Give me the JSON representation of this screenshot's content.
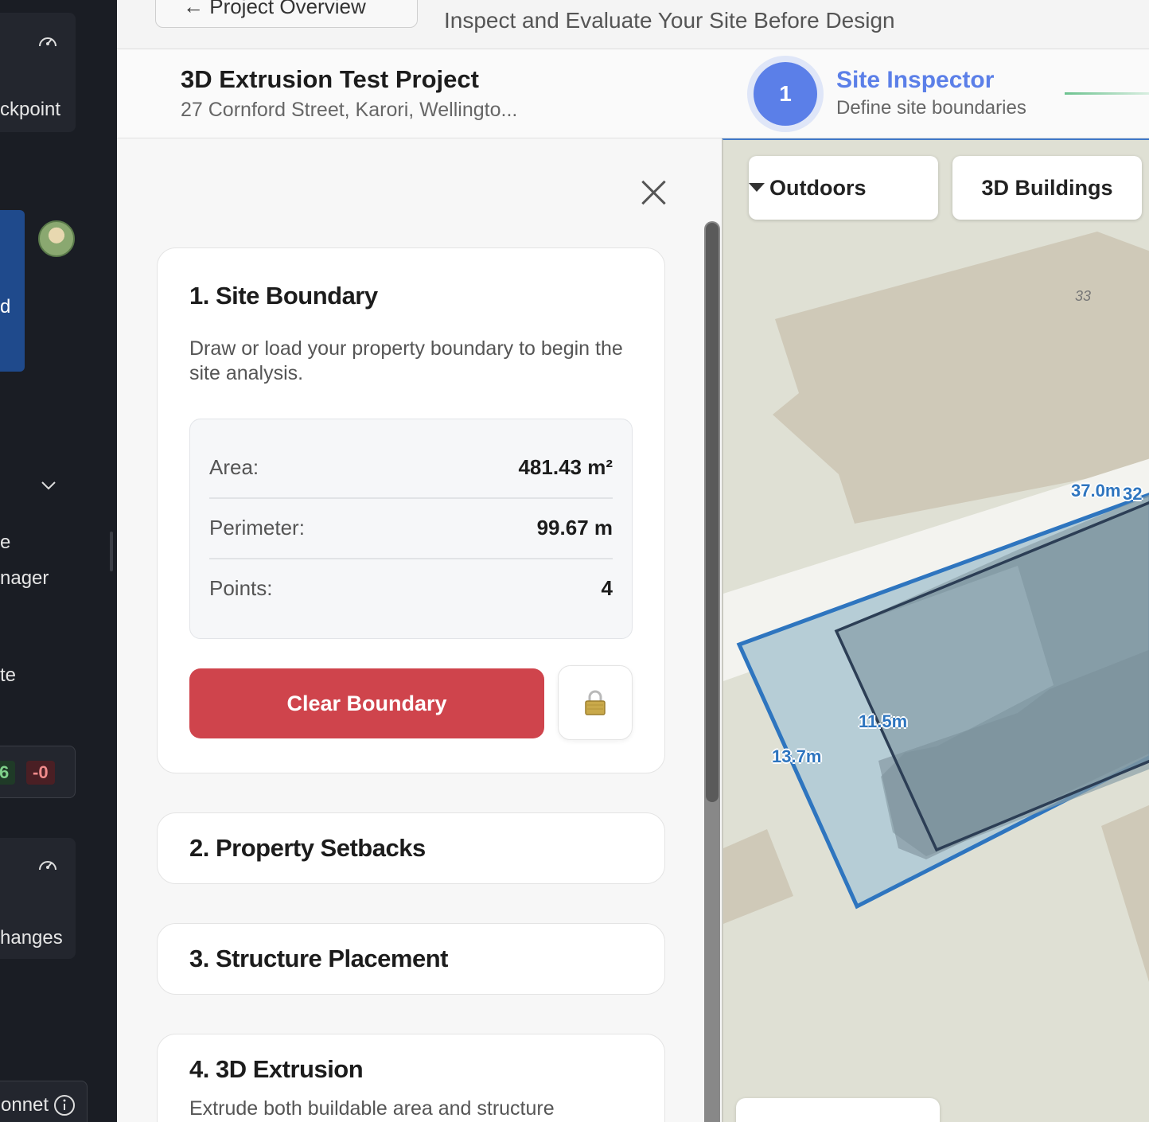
{
  "sidebar": {
    "checkpoint_label": "ckpoint",
    "blue_card_text": "d",
    "item_e": "e",
    "item_manager": "nager",
    "item_te": "te",
    "badge_added": "6",
    "badge_removed": "-0",
    "changes_label": "hanges",
    "model_label": "onnet"
  },
  "header": {
    "back_label": "← Project Overview",
    "subtitle": "Inspect and Evaluate Your Site Before Design"
  },
  "project": {
    "title": "3D Extrusion Test Project",
    "address": "27 Cornford Street, Karori, Wellingto..."
  },
  "step": {
    "number": "1",
    "title": "Site Inspector",
    "subtitle": "Define site boundaries"
  },
  "sections": {
    "site_boundary": {
      "title": "1. Site Boundary",
      "description": "Draw or load your property boundary to begin the site analysis.",
      "stats": [
        {
          "label": "Area:",
          "value": "481.43 m²"
        },
        {
          "label": "Perimeter:",
          "value": "99.67 m"
        },
        {
          "label": "Points:",
          "value": "4"
        }
      ],
      "clear_label": "Clear Boundary",
      "lock_glyph": "🔒"
    },
    "setbacks": {
      "title": "2. Property Setbacks"
    },
    "placement": {
      "title": "3. Structure Placement"
    },
    "extrusion": {
      "title": "4. 3D Extrusion",
      "description": "Extrude both buildable area and structure"
    }
  },
  "map": {
    "style_select": "Outdoors",
    "buildings_toggle": "3D Buildings",
    "lot_number": "33",
    "dimensions": [
      "37.0m",
      "32",
      "11.5m",
      "13.7m"
    ],
    "boundary_color": "#2e75bf",
    "structure_color": "#2c3e55"
  },
  "icons": {
    "close": "close-icon",
    "lock": "lock-icon",
    "dropdown": "caret-down-icon",
    "gauge": "gauge-icon",
    "chevron": "chevron-down-icon",
    "info": "info-icon"
  }
}
